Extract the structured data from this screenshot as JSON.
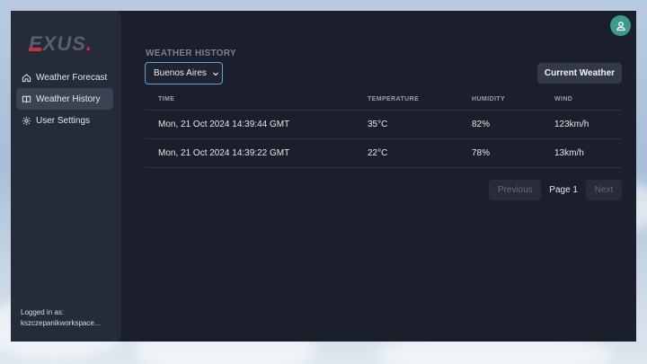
{
  "colors": {
    "accent": "#5aa2e0",
    "brand_red": "#c7323b",
    "avatar_bg": "#3b9a89",
    "sidebar_bg": "#262b38",
    "main_bg": "#1b1f2b"
  },
  "brand": {
    "logo_text": "EXUS",
    "logo_dot": "."
  },
  "sidebar": {
    "items": [
      {
        "label": "Weather Forecast",
        "icon": "home-icon",
        "active": false
      },
      {
        "label": "Weather History",
        "icon": "book-icon",
        "active": true
      },
      {
        "label": "User Settings",
        "icon": "gear-icon",
        "active": false
      }
    ],
    "login_label": "Logged in as:",
    "username": "kszczepanikworkspace..."
  },
  "header": {
    "avatar_icon": "user-icon"
  },
  "main": {
    "section_title": "WEATHER HISTORY",
    "city_select": {
      "value": "Buenos Aires",
      "icon": "chevron-down-icon"
    },
    "current_weather_button": "Current Weather",
    "table": {
      "headers": [
        "TIME",
        "TEMPERATURE",
        "HUMIDITY",
        "WIND"
      ],
      "rows": [
        [
          "Mon, 21 Oct 2024 14:39:44 GMT",
          "35°C",
          "82%",
          "123km/h"
        ],
        [
          "Mon, 21 Oct 2024 14:39:22 GMT",
          "22°C",
          "78%",
          "13km/h"
        ]
      ]
    },
    "pagination": {
      "previous": "Previous",
      "page": "Page 1",
      "next": "Next"
    }
  }
}
